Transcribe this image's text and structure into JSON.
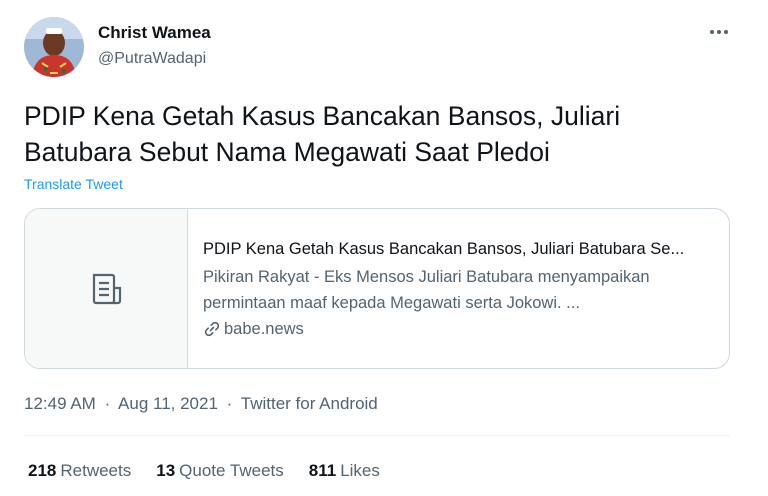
{
  "author": {
    "name": "Christ Wamea",
    "handle": "@PutraWadapi"
  },
  "tweet": {
    "text": "PDIP Kena Getah Kasus Bancakan Bansos, Juliari Batubara Sebut Nama Megawati Saat Pledoi",
    "translate_label": "Translate Tweet"
  },
  "card": {
    "title": "PDIP Kena Getah Kasus Bancakan Bansos, Juliari Batubara Se...",
    "description": "Pikiran Rakyat - Eks Mensos Juliari Batubara menyampaikan permintaan maaf kepada Megawati serta Jokowi. ...",
    "domain": "babe.news",
    "thumbnail_icon": "document-icon"
  },
  "meta": {
    "time": "12:49 AM",
    "date": "Aug 11, 2021",
    "separator": "·",
    "source": "Twitter for Android"
  },
  "stats": {
    "retweets_count": "218",
    "retweets_label": "Retweets",
    "quotes_count": "13",
    "quotes_label": "Quote Tweets",
    "likes_count": "811",
    "likes_label": "Likes"
  },
  "colors": {
    "link": "#1d9bf0",
    "secondary_text": "#536471",
    "primary_text": "#0f1419",
    "border": "#cfd9de"
  }
}
